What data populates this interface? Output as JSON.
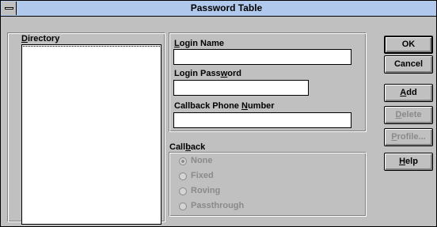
{
  "window": {
    "title": "Password Table"
  },
  "directory": {
    "label_pre": "",
    "label_ul": "D",
    "label_post": "irectory"
  },
  "login_name": {
    "label_pre": "",
    "label_ul": "L",
    "label_post": "ogin Name",
    "value": ""
  },
  "login_password": {
    "label_pre": "Login Pass",
    "label_ul": "w",
    "label_post": "ord",
    "value": ""
  },
  "callback_phone": {
    "label_pre": "Callback Phone ",
    "label_ul": "N",
    "label_post": "umber",
    "value": ""
  },
  "callback": {
    "label_pre": "Call",
    "label_ul": "b",
    "label_post": "ack",
    "options": [
      "None",
      "Fixed",
      "Roving",
      "Passthrough"
    ],
    "selected": "None",
    "enabled": false
  },
  "buttons": {
    "ok": {
      "pre": "",
      "ul": "",
      "post": "OK"
    },
    "cancel": {
      "pre": "",
      "ul": "",
      "post": "Cancel"
    },
    "add": {
      "pre": "",
      "ul": "A",
      "post": "dd"
    },
    "delete": {
      "pre": "",
      "ul": "D",
      "post": "elete"
    },
    "profile": {
      "pre": "",
      "ul": "P",
      "post": "rofile..."
    },
    "help": {
      "pre": "",
      "ul": "H",
      "post": "elp"
    }
  },
  "colors": {
    "titlebar": "#b0c8ec",
    "face": "#c0c0c0",
    "disabled_text": "#8a8a8a"
  }
}
